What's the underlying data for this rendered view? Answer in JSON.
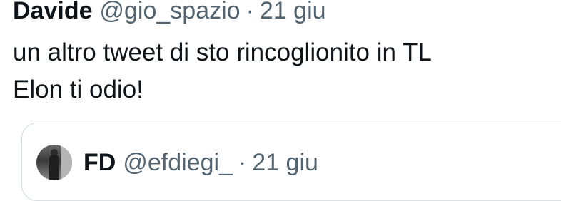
{
  "tweet": {
    "display_name": "Davide",
    "handle": "@gio_spazio",
    "separator": "·",
    "time": "21 giu",
    "text_line1": "un altro tweet di sto rincoglionito in TL",
    "text_line2": "Elon ti odio!"
  },
  "quoted_tweet": {
    "avatar": "profile-photo-icon",
    "display_name": "FD",
    "handle": "@efdiegi_",
    "separator": "·",
    "time": "21 giu"
  },
  "colors": {
    "text_primary": "#0f1419",
    "text_secondary": "#536471",
    "border": "#cfd9de",
    "background": "#ffffff"
  }
}
